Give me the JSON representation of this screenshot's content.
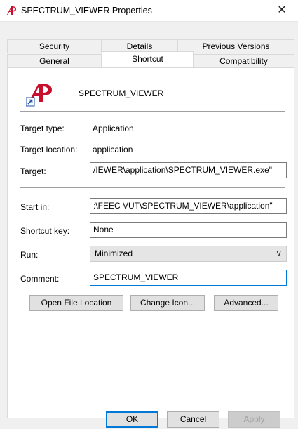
{
  "window": {
    "title": "SPECTRUM_VIEWER Properties",
    "close_glyph": "✕"
  },
  "tabs": {
    "row1": [
      "Security",
      "Details",
      "Previous Versions"
    ],
    "row2": [
      "General",
      "Shortcut",
      "Compatibility"
    ],
    "active": "Shortcut"
  },
  "header": {
    "app_name": "SPECTRUM_VIEWER",
    "icon": "shortcut-app-icon"
  },
  "fields": {
    "target_type_label": "Target type:",
    "target_type_value": "Application",
    "target_location_label": "Target location:",
    "target_location_value": "application",
    "target_label": "Target:",
    "target_value": "/IEWER\\application\\SPECTRUM_VIEWER.exe\"",
    "start_in_label": "Start in:",
    "start_in_value": ":\\FEEC VUT\\SPECTRUM_VIEWER\\application\"",
    "shortcut_key_label": "Shortcut key:",
    "shortcut_key_value": "None",
    "run_label": "Run:",
    "run_value": "Minimized",
    "comment_label": "Comment:",
    "comment_value": "SPECTRUM_VIEWER"
  },
  "actions": {
    "open_file_location": "Open File Location",
    "change_icon": "Change Icon...",
    "advanced": "Advanced..."
  },
  "footer": {
    "ok": "OK",
    "cancel": "Cancel",
    "apply": "Apply"
  },
  "colors": {
    "accent": "#0078d7",
    "logo_red": "#c8102e"
  }
}
